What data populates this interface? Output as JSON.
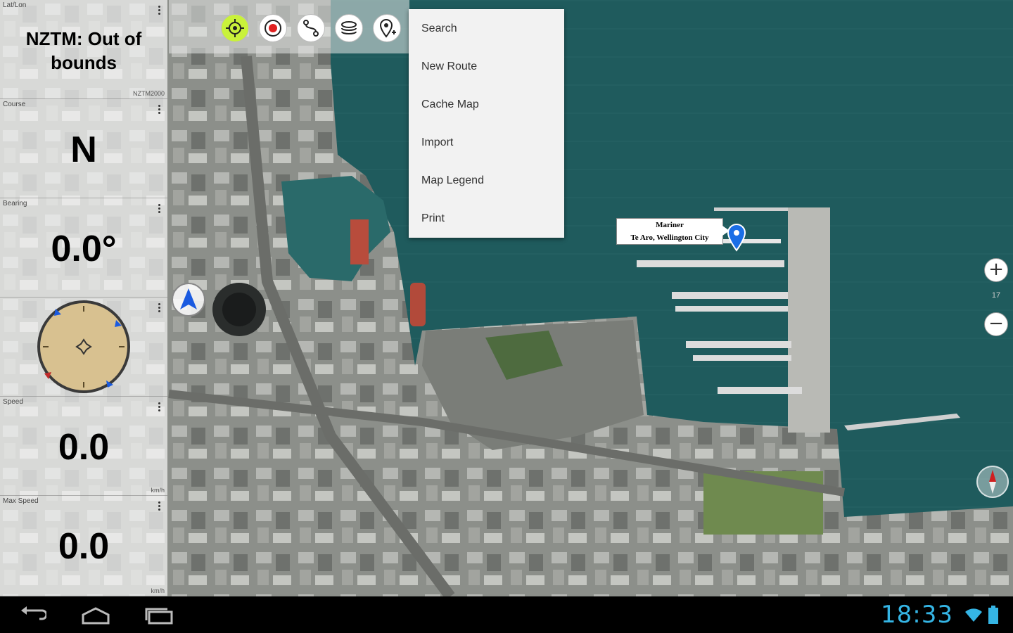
{
  "panel": {
    "tiles": [
      {
        "label": "Lat/Lon",
        "value": "NZTM: Out of bounds",
        "unit": "NZTM2000"
      },
      {
        "label": "Course",
        "value": "N",
        "unit": ""
      },
      {
        "label": "Bearing",
        "value": "0.0°",
        "unit": ""
      },
      {
        "label": "",
        "value": "",
        "unit": "",
        "widget": "compass"
      },
      {
        "label": "Speed",
        "value": "0.0",
        "unit": "km/h"
      },
      {
        "label": "Max Speed",
        "value": "0.0",
        "unit": "km/h"
      }
    ]
  },
  "toolbar": {
    "buttons": [
      {
        "name": "my-location",
        "icon": "crosshair-icon",
        "active": true,
        "color": "#c9f23a"
      },
      {
        "name": "record",
        "icon": "record-icon",
        "active": false,
        "color": "#e02020"
      },
      {
        "name": "route",
        "icon": "route-icon",
        "active": false
      },
      {
        "name": "layers",
        "icon": "layers-icon",
        "active": false
      },
      {
        "name": "waypoint",
        "icon": "waypoint-icon",
        "active": false
      }
    ]
  },
  "menu": {
    "items": [
      "Search",
      "New Route",
      "Cache Map",
      "Import",
      "Map Legend",
      "Print"
    ]
  },
  "marker": {
    "title": "Mariner",
    "subtitle": "Te Aro, Wellington City",
    "color": "#1a6ee6"
  },
  "zoom": {
    "in_label": "+",
    "out_label": "−",
    "level": "17"
  },
  "statusbar": {
    "time": "18:33",
    "accent": "#35b5e5"
  },
  "colors": {
    "water": "#1e5a5c",
    "land": "#8a8d88"
  }
}
